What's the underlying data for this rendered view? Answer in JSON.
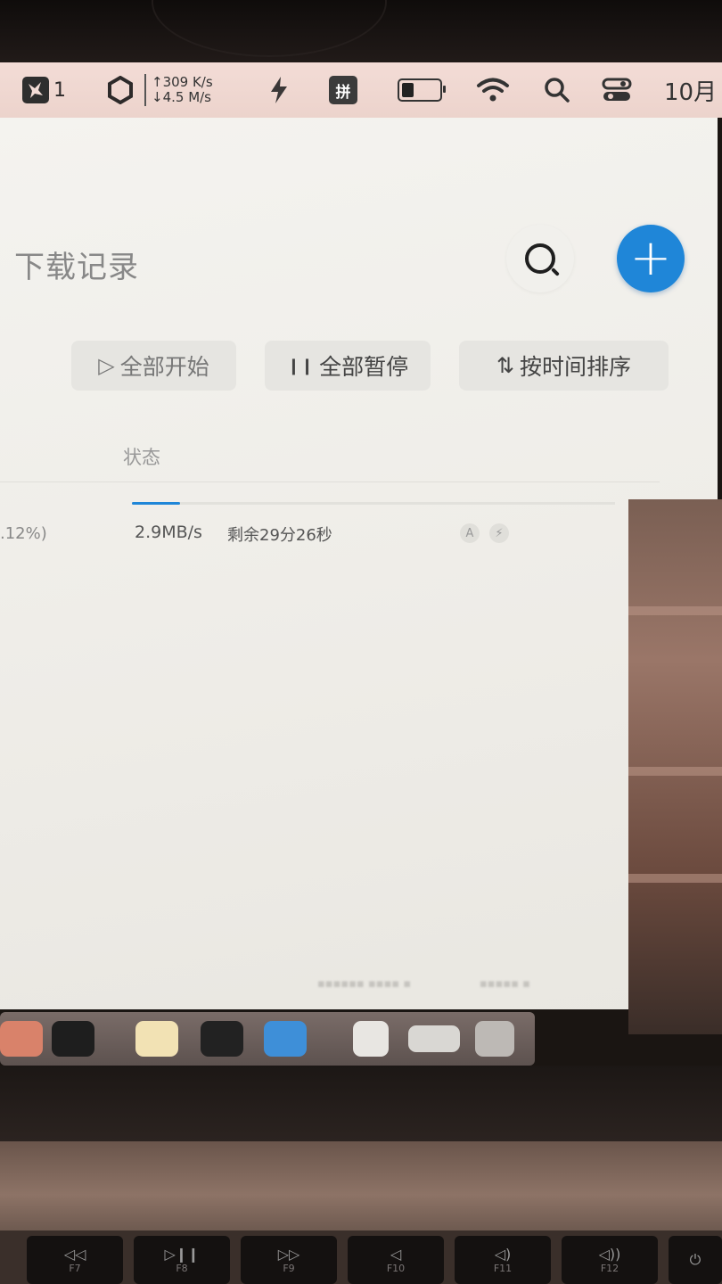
{
  "menubar": {
    "app_badge_count": "1",
    "net_up": "↑309 K/s",
    "net_down": "↓4.5 M/s",
    "input_method": "拼",
    "clock": "10月"
  },
  "page": {
    "title": "下载记录"
  },
  "toolbar": {
    "start_all": "全部开始",
    "pause_all": "全部暂停",
    "sort_by_time": "按时间排序",
    "start_icon": "▷",
    "pause_icon": "❙❙",
    "sort_icon": "⇅"
  },
  "table": {
    "header_status": "状态"
  },
  "download": {
    "percent_text": ".12%)",
    "speed": "2.9MB/s",
    "remaining": "剩余29分26秒",
    "progress_fraction": 0.1
  },
  "accent_color": "#1f86d8"
}
